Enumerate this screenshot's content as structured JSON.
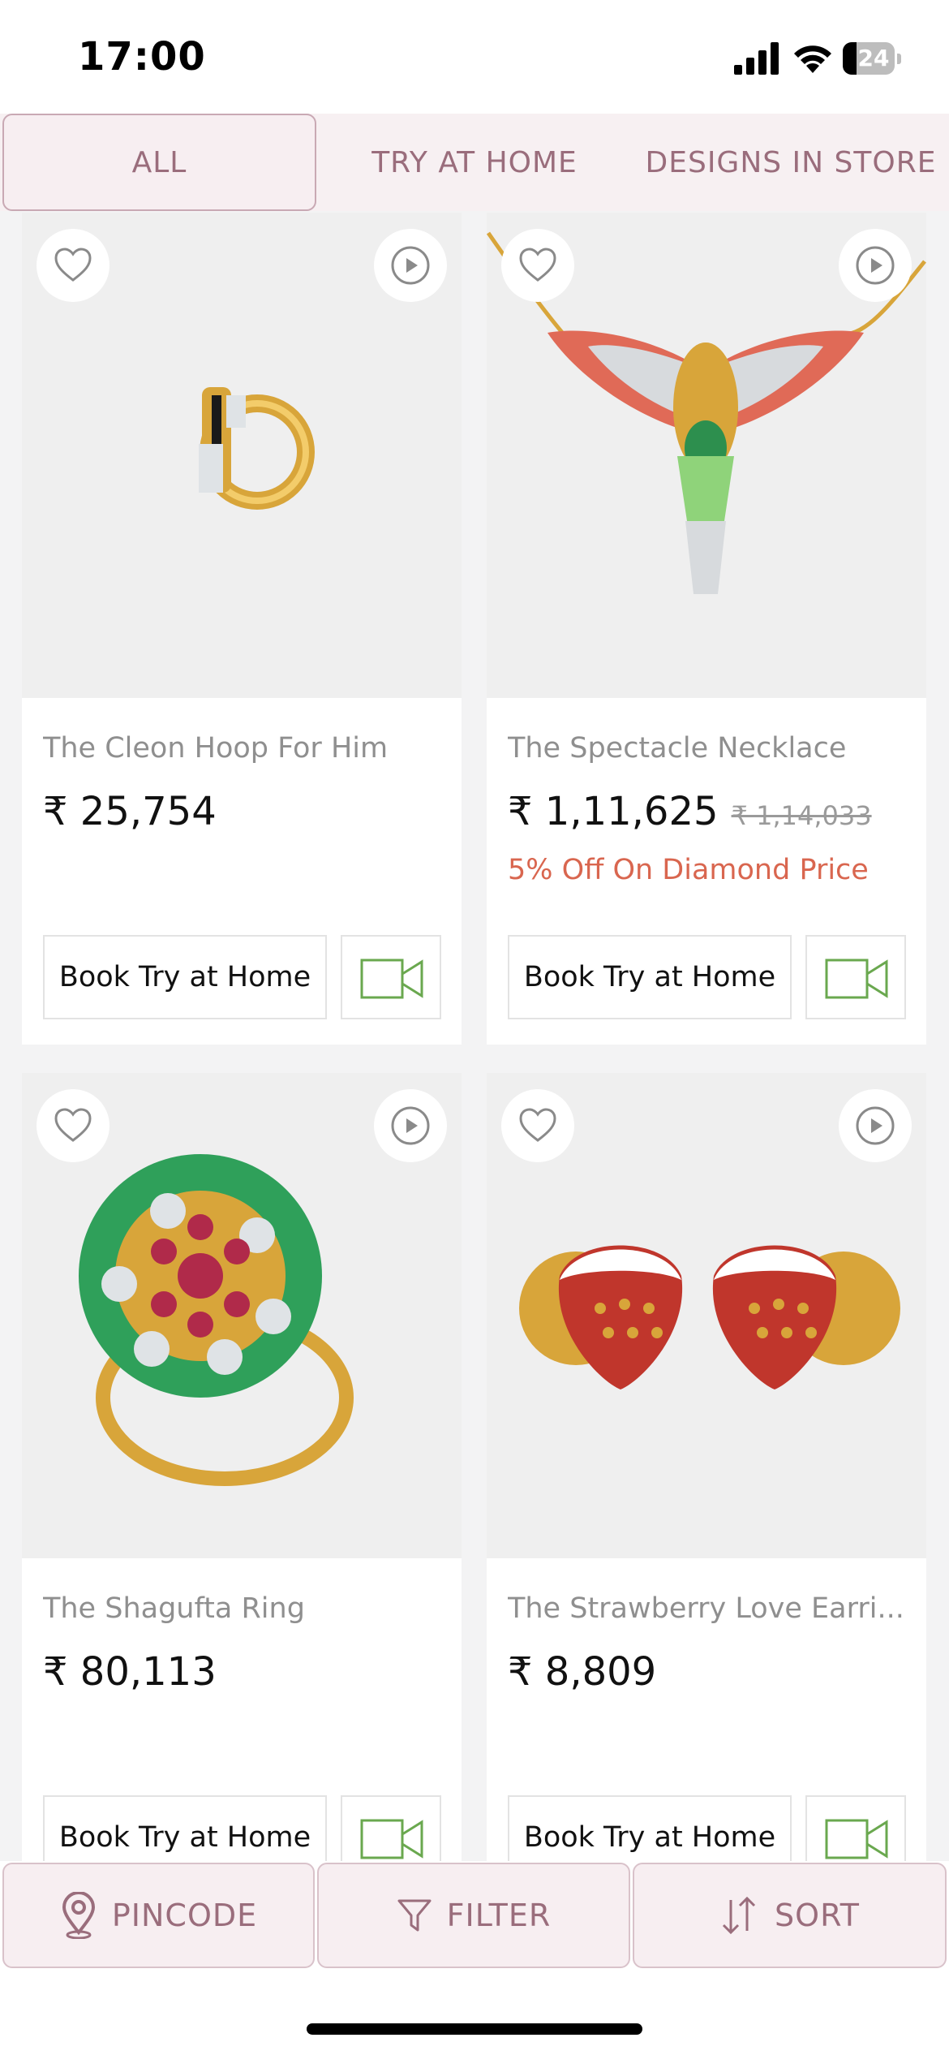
{
  "status_bar": {
    "time": "17:00",
    "battery": "24"
  },
  "tabs": [
    {
      "label": "ALL",
      "active": true
    },
    {
      "label": "TRY AT HOME",
      "active": false
    },
    {
      "label": "DESIGNS IN STORE",
      "active": false
    }
  ],
  "products": [
    {
      "name": "The Cleon Hoop For Him",
      "price": "₹ 25,754",
      "old_price": "",
      "discount": "",
      "book_label": "Book Try at Home"
    },
    {
      "name": "The Spectacle Necklace",
      "price": "₹ 1,11,625",
      "old_price": "₹ 1,14,033",
      "discount": "5% Off On Diamond Price",
      "book_label": "Book Try at Home"
    },
    {
      "name": "The Shagufta Ring",
      "price": "₹ 80,113",
      "old_price": "",
      "discount": "",
      "book_label": "Book Try at Home"
    },
    {
      "name": "The Strawberry Love Earri...",
      "price": "₹ 8,809",
      "old_price": "",
      "discount": "",
      "book_label": "Book Try at Home"
    }
  ],
  "bottom_bar": {
    "pincode": "PINCODE",
    "filter": "FILTER",
    "sort": "SORT"
  },
  "colors": {
    "accent": "#9a6d7c",
    "discount": "#d9664f",
    "video_icon": "#6aa84f"
  }
}
